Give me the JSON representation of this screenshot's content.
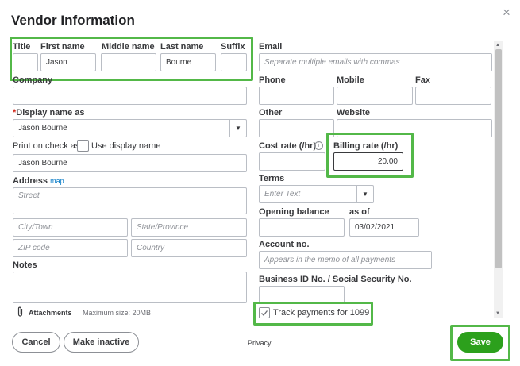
{
  "dialog": {
    "title": "Vendor Information",
    "close_glyph": "×"
  },
  "name": {
    "title_label": "Title",
    "first_label": "First name",
    "middle_label": "Middle name",
    "last_label": "Last name",
    "suffix_label": "Suffix",
    "title_value": "",
    "first_value": "Jason",
    "middle_value": "",
    "last_value": "Bourne",
    "suffix_value": ""
  },
  "company": {
    "label": "Company",
    "value": ""
  },
  "display_name": {
    "required_mark": "*",
    "label": "Display name as",
    "value": "Jason Bourne"
  },
  "print_on_check": {
    "label": "Print on check as",
    "checkbox_label": "Use display name",
    "value": "Jason Bourne"
  },
  "address": {
    "label": "Address",
    "map_link": "map",
    "street_placeholder": "Street",
    "city_placeholder": "City/Town",
    "state_placeholder": "State/Province",
    "zip_placeholder": "ZIP code",
    "country_placeholder": "Country"
  },
  "notes": {
    "label": "Notes"
  },
  "attachments": {
    "label": "Attachments",
    "max_size": "Maximum size: 20MB"
  },
  "email": {
    "label": "Email",
    "placeholder": "Separate multiple emails with commas"
  },
  "phones": {
    "phone_label": "Phone",
    "mobile_label": "Mobile",
    "fax_label": "Fax",
    "other_label": "Other",
    "website_label": "Website"
  },
  "rates": {
    "cost_label": "Cost rate (/hr)",
    "info_glyph": "i",
    "billing_label": "Billing rate (/hr)",
    "billing_value": "20.00"
  },
  "terms": {
    "label": "Terms",
    "placeholder": "Enter Text"
  },
  "opening_balance": {
    "label": "Opening balance",
    "as_of_label": "as of",
    "date_value": "03/02/2021"
  },
  "account_no": {
    "label": "Account no.",
    "placeholder": "Appears in the memo of all payments"
  },
  "business_id": {
    "label": "Business ID No. / Social Security No."
  },
  "track_1099": {
    "label": "Track payments for 1099",
    "checked": true
  },
  "footer": {
    "cancel": "Cancel",
    "make_inactive": "Make inactive",
    "privacy": "Privacy",
    "save": "Save"
  },
  "colors": {
    "highlight_green": "#53b848",
    "save_green": "#2ca01c",
    "link_blue": "#0077c5"
  }
}
